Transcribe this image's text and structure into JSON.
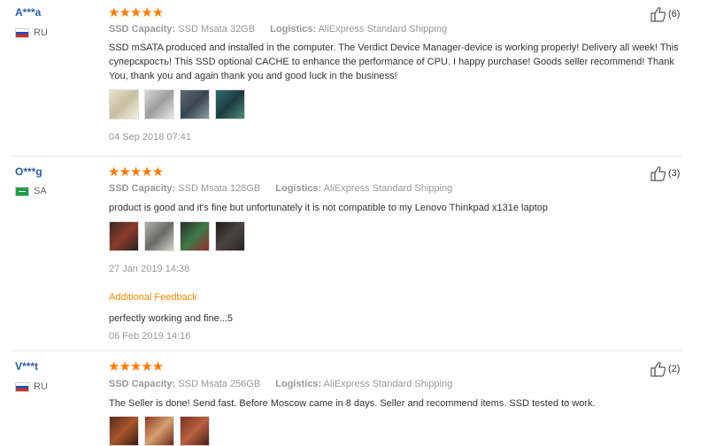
{
  "reviews": [
    {
      "user": "A***a",
      "country": "RU",
      "stars": "★★★★★",
      "attr1_label": "SSD Capacity:",
      "attr1_value": "SSD Msata 32GB",
      "attr2_label": "Logistics:",
      "attr2_value": "AliExpress Standard Shipping",
      "text": "SSD mSATA produced and installed in the computer. The Verdict Device Manager-device is working properly! Delivery all week! This суперскрость! This SSD optional CACHE to enhance the performance of CPU. I happy purchase! Goods seller recommend! Thank You, thank you and again thank you and good luck in the business!",
      "date": "04 Sep 2018 07:41",
      "helpful": "(6)"
    },
    {
      "user": "O***g",
      "country": "SA",
      "stars": "★★★★★",
      "attr1_label": "SSD Capacity:",
      "attr1_value": "SSD Msata 128GB",
      "attr2_label": "Logistics:",
      "attr2_value": "AliExpress Standard Shipping",
      "text": "product is good and it's fine but unfortunately it is not compatible to my Lenovo Thinkpad x131e laptop",
      "date": "27 Jan 2019 14:38",
      "helpful": "(3)",
      "additional_label": "Additional Feedback",
      "additional_text": "perfectly working and fine...5",
      "additional_date": "06 Feb 2019 14:16"
    },
    {
      "user": "V***t",
      "country": "RU",
      "stars": "★★★★★",
      "attr1_label": "SSD Capacity:",
      "attr1_value": "SSD Msata 256GB",
      "attr2_label": "Logistics:",
      "attr2_value": "AliExpress Standard Shipping",
      "text": "The Seller is done! Send fast. Before Moscow came in 8 days. Seller and recommend items. SSD tested to work.",
      "helpful": "(2)"
    }
  ],
  "colors": {
    "user": "#2a5db0",
    "star": "#ff7a00",
    "additional": "#f28a00"
  }
}
